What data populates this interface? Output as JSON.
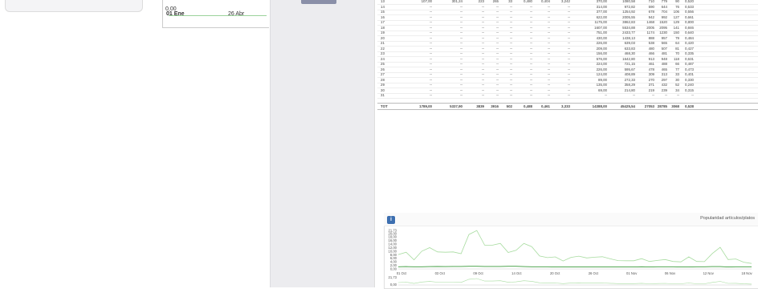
{
  "left": {
    "mini_chart": {
      "y_zero": "0,00",
      "x_labels": [
        "01 Ene",
        "26 Abr"
      ]
    }
  },
  "table": {
    "rows": [
      [
        "13",
        "107,00",
        "301,24",
        "223",
        "265",
        "33",
        "0,480",
        "0,404",
        "3,242",
        "370,00",
        "1080,58",
        "710",
        "779",
        "90",
        "0,520"
      ],
      [
        "14",
        "--",
        "--",
        "--",
        "--",
        "--",
        "--",
        "--",
        "--",
        "314,00",
        "972,82",
        "590",
        "644",
        "76",
        "0,533"
      ],
      [
        "15",
        "--",
        "--",
        "--",
        "--",
        "--",
        "--",
        "--",
        "--",
        "377,00",
        "1254,92",
        "678",
        "704",
        "106",
        "0,556"
      ],
      [
        "16",
        "--",
        "--",
        "--",
        "--",
        "--",
        "--",
        "--",
        "--",
        "622,00",
        "2005,55",
        "942",
        "992",
        "127",
        "0,661"
      ],
      [
        "17",
        "--",
        "--",
        "--",
        "--",
        "--",
        "--",
        "--",
        "--",
        "1175,00",
        "3862,83",
        "1468",
        "1520",
        "129",
        "0,800"
      ],
      [
        "18",
        "--",
        "--",
        "--",
        "--",
        "--",
        "--",
        "--",
        "--",
        "1607,00",
        "5534,88",
        "2005",
        "2095",
        "141",
        "0,846"
      ],
      [
        "19",
        "--",
        "--",
        "--",
        "--",
        "--",
        "--",
        "--",
        "--",
        "751,00",
        "2433,77",
        "1174",
        "1230",
        "150",
        "0,640"
      ],
      [
        "20",
        "--",
        "--",
        "--",
        "--",
        "--",
        "--",
        "--",
        "--",
        "430,00",
        "1438,13",
        "888",
        "957",
        "79",
        "0,484"
      ],
      [
        "21",
        "--",
        "--",
        "--",
        "--",
        "--",
        "--",
        "--",
        "--",
        "226,00",
        "639,03",
        "538",
        "565",
        "64",
        "0,420"
      ],
      [
        "22",
        "--",
        "--",
        "--",
        "--",
        "--",
        "--",
        "--",
        "--",
        "209,00",
        "633,83",
        "480",
        "507",
        "81",
        "0,427"
      ],
      [
        "23",
        "--",
        "--",
        "--",
        "--",
        "--",
        "--",
        "--",
        "--",
        "156,00",
        "468,30",
        "466",
        "481",
        "70",
        "0,335"
      ],
      [
        "24",
        "--",
        "--",
        "--",
        "--",
        "--",
        "--",
        "--",
        "--",
        "576,00",
        "1642,80",
        "913",
        "948",
        "118",
        "0,631"
      ],
      [
        "25",
        "--",
        "--",
        "--",
        "--",
        "--",
        "--",
        "--",
        "--",
        "224,00",
        "721,15",
        "461",
        "488",
        "66",
        "0,487"
      ],
      [
        "26",
        "--",
        "--",
        "--",
        "--",
        "--",
        "--",
        "--",
        "--",
        "226,00",
        "595,67",
        "478",
        "465",
        "77",
        "0,473"
      ],
      [
        "27",
        "--",
        "--",
        "--",
        "--",
        "--",
        "--",
        "--",
        "--",
        "124,00",
        "408,89",
        "309",
        "313",
        "33",
        "0,401"
      ],
      [
        "28",
        "--",
        "--",
        "--",
        "--",
        "--",
        "--",
        "--",
        "--",
        "89,00",
        "272,33",
        "270",
        "297",
        "30",
        "0,330"
      ],
      [
        "29",
        "--",
        "--",
        "--",
        "--",
        "--",
        "--",
        "--",
        "--",
        "135,00",
        "358,29",
        "371",
        "432",
        "52",
        "0,240"
      ],
      [
        "30",
        "--",
        "--",
        "--",
        "--",
        "--",
        "--",
        "--",
        "--",
        "69,00",
        "214,80",
        "219",
        "239",
        "34",
        "0,315"
      ],
      [
        "31",
        "--",
        "--",
        "--",
        "--",
        "--",
        "--",
        "--",
        "--",
        "--",
        "--",
        "--",
        "--",
        "--",
        "--"
      ],
      [
        "TOT",
        "1789,00",
        "5337,90",
        "3839",
        "3916",
        "502",
        "0,488",
        "0,461",
        "3,333",
        "14388,00",
        "45425,54",
        "27053",
        "28785",
        "3068",
        "0,528"
      ]
    ]
  },
  "chart_panel": {
    "title": "Popularidad artículos/platos",
    "info_icon": "info-icon"
  },
  "chart_data": {
    "type": "line",
    "x": [
      "01 Oct",
      "03 Oct",
      "09 Oct",
      "14 Oct",
      "20 Oct",
      "26 Oct",
      "01 Nov",
      "06 Nov",
      "12 Nov",
      "18 Nov"
    ],
    "y_ticks": [
      "21,73",
      "20,00",
      "18,00",
      "16,00",
      "14,00",
      "12,00",
      "10,00",
      "8,00",
      "6,00",
      "4,00",
      "2,00",
      "0,00"
    ],
    "ylim": [
      0,
      21.73
    ],
    "series": [
      {
        "color": "#a8dca0",
        "values": [
          8.1,
          9.4,
          5.1,
          10.0,
          12.0,
          9.6,
          9.4,
          9.6,
          8.6,
          19.4,
          21.7,
          13.4,
          13.4,
          14.4,
          9.3,
          10.5,
          14.4,
          12.6,
          7.3,
          6.4,
          6.8,
          4.5,
          6.5,
          7.2,
          6.2,
          6.6,
          6.9,
          5.7,
          4.7,
          4.6,
          4.6,
          5.8,
          4.2,
          4.8,
          5.3,
          4.2,
          4.0,
          6.8,
          4.2,
          4.1,
          8.7,
          12.2,
          5.3,
          5.6,
          3.8,
          3.1
        ]
      },
      {
        "color": "#3a9a3a",
        "values": [
          1.2,
          1.3,
          1.2,
          1.2,
          1.3,
          1.4,
          1.3,
          1.4,
          1.4,
          1.5,
          1.5,
          1.4,
          1.4,
          1.4,
          1.5,
          1.5,
          1.3,
          1.2,
          1.2,
          1.2,
          1.1,
          1.1,
          1.1,
          1.1,
          1.1,
          1.1,
          1.1,
          1.1,
          1.1,
          1.1,
          1.1,
          1.2,
          1.1,
          1.2,
          1.2,
          1.2,
          1.1,
          1.1,
          1.2,
          1.2,
          1.3,
          1.3,
          1.1,
          1.2,
          1.2,
          1.2
        ]
      }
    ],
    "second_chart_visible": {
      "y_top": "21,73",
      "y_zero": "0,00"
    }
  }
}
